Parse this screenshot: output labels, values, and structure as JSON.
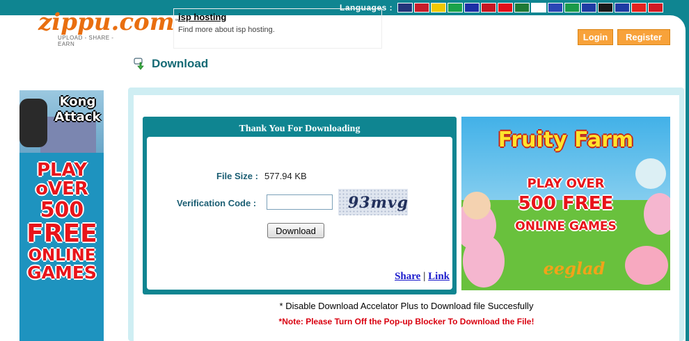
{
  "header": {
    "languages_label": "Languages :",
    "flags": [
      {
        "name": "uk-flag-icon",
        "color": "#24357a"
      },
      {
        "name": "thailand-flag-icon",
        "color": "#c61d2a"
      },
      {
        "name": "spain-flag-icon",
        "color": "#f0c800"
      },
      {
        "name": "brazil-flag-icon",
        "color": "#1aa34a"
      },
      {
        "name": "eu-flag-icon",
        "color": "#1c2fa5"
      },
      {
        "name": "malaysia-flag-icon",
        "color": "#c51722"
      },
      {
        "name": "indonesia-flag-icon",
        "color": "#e20f1a"
      },
      {
        "name": "saudi-flag-icon",
        "color": "#1f7a36"
      },
      {
        "name": "japan-flag-icon",
        "color": "#ffffff"
      },
      {
        "name": "russia-flag-icon",
        "color": "#2b46b5"
      },
      {
        "name": "italy-flag-icon",
        "color": "#1a9a4a"
      },
      {
        "name": "france-flag-icon",
        "color": "#1e3ba3"
      },
      {
        "name": "belgium-flag-icon",
        "color": "#1a1a1a"
      },
      {
        "name": "romania-flag-icon",
        "color": "#1e3ba3"
      },
      {
        "name": "china-flag-icon",
        "color": "#e3231e"
      },
      {
        "name": "taiwan-flag-icon",
        "color": "#d01a24"
      }
    ]
  },
  "logo": {
    "text": "zippu.com",
    "tm": "™",
    "tagline": "UPLOAD - SHARE - EARN"
  },
  "ad": {
    "title": "isp hosting",
    "description": "Find more about isp hosting."
  },
  "auth": {
    "login_label": "Login",
    "register_label": "Register"
  },
  "page": {
    "title": "Download"
  },
  "side_banner": {
    "game": "Kong Attack",
    "lines": [
      "PLAY",
      "oVER",
      "500",
      "FREE",
      "ONLINE",
      "GAMES"
    ]
  },
  "download_box": {
    "title": "Thank You For Downloading",
    "file_size_label": "File Size :",
    "file_size_value": "577.94 KB",
    "verification_label": "Verification Code :",
    "verification_value": "",
    "captcha_text": "93mvg",
    "download_button": "Download",
    "share_link": "Share",
    "separator": "|",
    "link_link": "Link"
  },
  "promo": {
    "title": "Fruity Farm",
    "line1": "PLAY OVER",
    "line2": "500 FREE",
    "line3": "ONLINE GAMES",
    "brand": "eeglad"
  },
  "notes": {
    "accelerator": "* Disable Download Accelator Plus to Download file Succesfully",
    "popup": "*Note: Please Turn Off the Pop-up Blocker To Download the File!"
  },
  "colors": {
    "teal": "#0f8591",
    "orange": "#f8a23a",
    "title_teal": "#146a75",
    "note_red": "#d9000f"
  }
}
